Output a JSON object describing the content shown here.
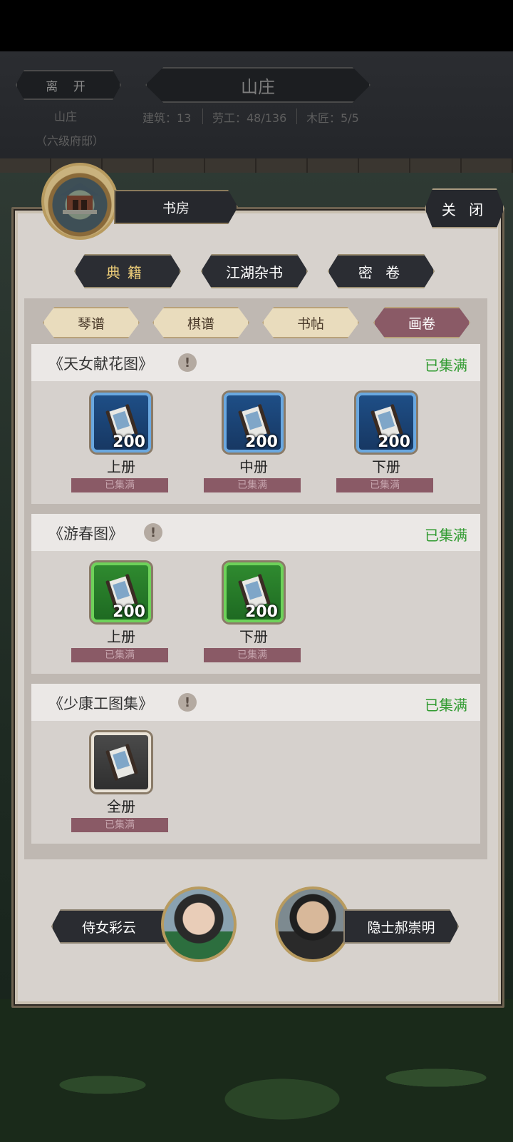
{
  "top_banner": {
    "leave_label": "离 开",
    "title": "山庄",
    "location": "山庄",
    "rank": "（六级府邸）",
    "stats": [
      "建筑：13",
      "劳工：48/136",
      "木匠：5/5"
    ]
  },
  "panel": {
    "room_name": "书房",
    "close_label": "关 闭",
    "categories": [
      "典籍",
      "江湖杂书",
      "密 卷"
    ],
    "sub_tabs": [
      "琴谱",
      "棋谱",
      "书帖",
      "画卷"
    ],
    "info_glyph": "!",
    "sections": [
      {
        "title": "《天女献花图》",
        "status": "已集满",
        "items": [
          {
            "name": "上册",
            "count": "200",
            "status": "已集满"
          },
          {
            "name": "中册",
            "count": "200",
            "status": "已集满"
          },
          {
            "name": "下册",
            "count": "200",
            "status": "已集满"
          }
        ]
      },
      {
        "title": "《游春图》",
        "status": "已集满",
        "items": [
          {
            "name": "上册",
            "count": "200",
            "status": "已集满"
          },
          {
            "name": "下册",
            "count": "200",
            "status": "已集满"
          }
        ]
      },
      {
        "title": "《少康工图集》",
        "status": "已集满",
        "items": [
          {
            "name": "全册",
            "status": "已集满"
          }
        ]
      }
    ],
    "npcs": [
      "侍女彩云",
      "隐士郝崇明"
    ]
  },
  "colors": {
    "accent_green": "#2f9a2f",
    "active_tab": "#8a5a66",
    "panel_bg": "#d7d2cd"
  }
}
